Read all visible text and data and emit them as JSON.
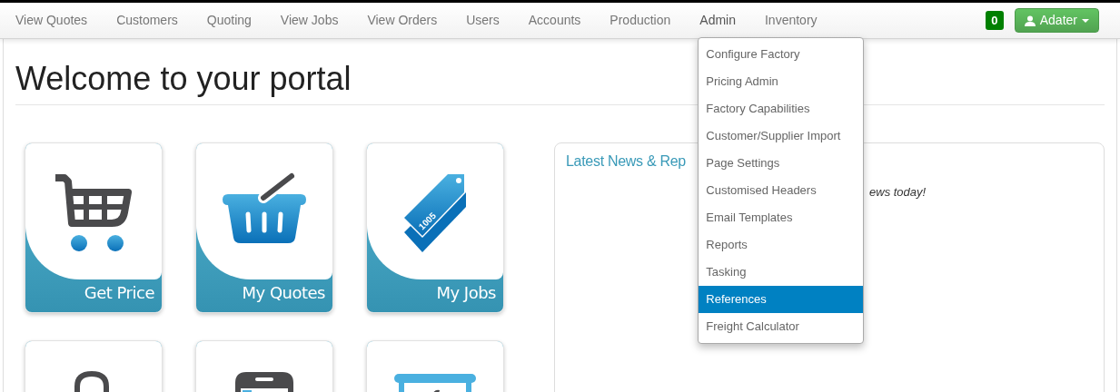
{
  "nav": {
    "items": [
      {
        "label": "View Quotes"
      },
      {
        "label": "Customers"
      },
      {
        "label": "Quoting"
      },
      {
        "label": "View Jobs"
      },
      {
        "label": "View Orders"
      },
      {
        "label": "Users"
      },
      {
        "label": "Accounts"
      },
      {
        "label": "Production"
      },
      {
        "label": "Admin",
        "expanded": true
      },
      {
        "label": "Inventory"
      }
    ],
    "notification_count": "0",
    "user_button": "Adater"
  },
  "admin_menu": [
    {
      "label": "Configure Factory",
      "selected": false
    },
    {
      "label": "Pricing Admin",
      "selected": false
    },
    {
      "label": "Factory Capabilities",
      "selected": false
    },
    {
      "label": "Customer/Supplier Import",
      "selected": false
    },
    {
      "label": "Page Settings",
      "selected": false
    },
    {
      "label": "Customised Headers",
      "selected": false
    },
    {
      "label": "Email Templates",
      "selected": false
    },
    {
      "label": "Reports",
      "selected": false
    },
    {
      "label": "Tasking",
      "selected": false
    },
    {
      "label": "References",
      "selected": true
    },
    {
      "label": "Freight Calculator",
      "selected": false
    }
  ],
  "heading": "Welcome to your portal",
  "tiles": [
    {
      "kind": "cart",
      "label": "Get Price"
    },
    {
      "kind": "basket",
      "label": "My Quotes"
    },
    {
      "kind": "tag",
      "label": "My Jobs",
      "tag_text": "1005"
    },
    {
      "kind": "bag"
    },
    {
      "kind": "phone"
    },
    {
      "kind": "board"
    }
  ],
  "news": {
    "title": "Latest News & Rep",
    "text": "ews today!"
  }
}
